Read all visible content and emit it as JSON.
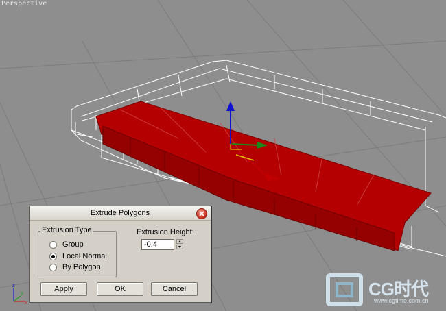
{
  "viewport": {
    "label": "Perspective"
  },
  "dialog": {
    "title": "Extrude Polygons",
    "extrusion_type": {
      "label": "Extrusion Type",
      "options": [
        "Group",
        "Local Normal",
        "By Polygon"
      ],
      "selected": "Local Normal"
    },
    "extrusion_height": {
      "label": "Extrusion Height:",
      "value": "-0.4"
    },
    "buttons": {
      "apply": "Apply",
      "ok": "OK",
      "cancel": "Cancel"
    }
  },
  "axis_indicator": {
    "x": "x",
    "y": "y",
    "z": "z"
  },
  "watermark": {
    "title": "CG时代",
    "url": "www.cgtime.com.cn"
  },
  "colors": {
    "viewport_bg": "#8e8e8e",
    "selected_polygons": "#b00000",
    "wireframe": "#ffffff",
    "dialog_bg": "#d4d0c8"
  }
}
